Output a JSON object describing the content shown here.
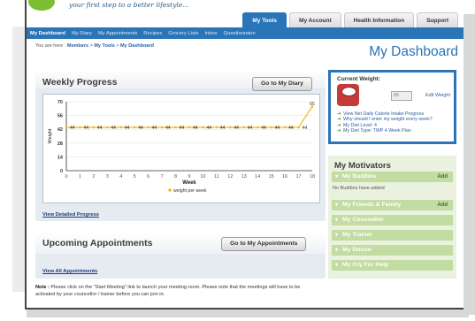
{
  "header": {
    "tagline": "your first step to a better lifestyle...",
    "tabs": [
      {
        "label": "My Tools",
        "active": true
      },
      {
        "label": "My Account",
        "active": false
      },
      {
        "label": "Health Information",
        "active": false
      },
      {
        "label": "Support",
        "active": false
      }
    ]
  },
  "nav": {
    "items": [
      "My Dashboard",
      "My Diary",
      "My Appointments",
      "Recipes",
      "Grocery Lists",
      "Inbox",
      "Questionnaire"
    ]
  },
  "breadcrumb": {
    "prefix": "You are here :",
    "items": [
      "Members",
      "My Tools",
      "My Dashboard"
    ]
  },
  "page_title": "My Dashboard",
  "weekly_progress": {
    "title": "Weekly Progress",
    "button": "Go to My Diary",
    "view_link": "View Detailed Progress"
  },
  "chart_data": {
    "type": "line",
    "xlabel": "Week",
    "ylabel": "Weight",
    "ylim": [
      0,
      70
    ],
    "yticks": [
      0,
      14,
      28,
      42,
      56,
      70
    ],
    "x": [
      0,
      1,
      2,
      3,
      4,
      5,
      6,
      7,
      8,
      9,
      10,
      11,
      12,
      13,
      14,
      15,
      16,
      17,
      18
    ],
    "series": [
      {
        "name": "weight per week",
        "values": [
          44,
          44,
          44,
          44,
          44,
          44,
          44,
          44,
          44,
          44,
          44,
          44,
          44,
          44,
          44,
          44,
          44,
          44,
          65
        ],
        "labels": [
          "44",
          "44",
          "44",
          "44",
          "44",
          "44",
          "44",
          "44",
          "44",
          "44",
          "44",
          "44",
          "44",
          "44",
          "44",
          "44",
          "44",
          "44",
          "65"
        ],
        "color": "#f5b100"
      }
    ],
    "grid": "horizontal",
    "legend": "bottom"
  },
  "appointments": {
    "title": "Upcoming Appointments",
    "button": "Go to My Appointments",
    "view_link": "View All Appointments"
  },
  "note": {
    "label": "Note :",
    "text": "Please click on the \"Start Meeting\" link to launch your meeting room. Please note that the meetings will have to be activated by your councellor / trainer before you can join in."
  },
  "current_weight": {
    "title": "Current Weight:",
    "value": "65",
    "edit_label": "Edit Weight",
    "links": [
      "View Net Daily Calorie Intake Progress",
      "Why should I enter my weight every week?",
      "My Diet Level: 4",
      "My Diet Type: TWP 4 Week Plan"
    ]
  },
  "motivators": {
    "title": "My Motivators",
    "items": [
      {
        "label": "My Buddies",
        "add": "Add"
      },
      {
        "label": "My Friends & Family",
        "add": "Add"
      },
      {
        "label": "My Counsellor",
        "add": ""
      },
      {
        "label": "My Trainer",
        "add": ""
      },
      {
        "label": "My Doctor",
        "add": ""
      },
      {
        "label": "My Cry For Help",
        "add": ""
      }
    ],
    "no_buddies": "No Buddies have added"
  },
  "colors": {
    "brand_blue": "#2a74b8",
    "series_orange": "#f5b100",
    "motivator_green": "#c2dca2"
  }
}
